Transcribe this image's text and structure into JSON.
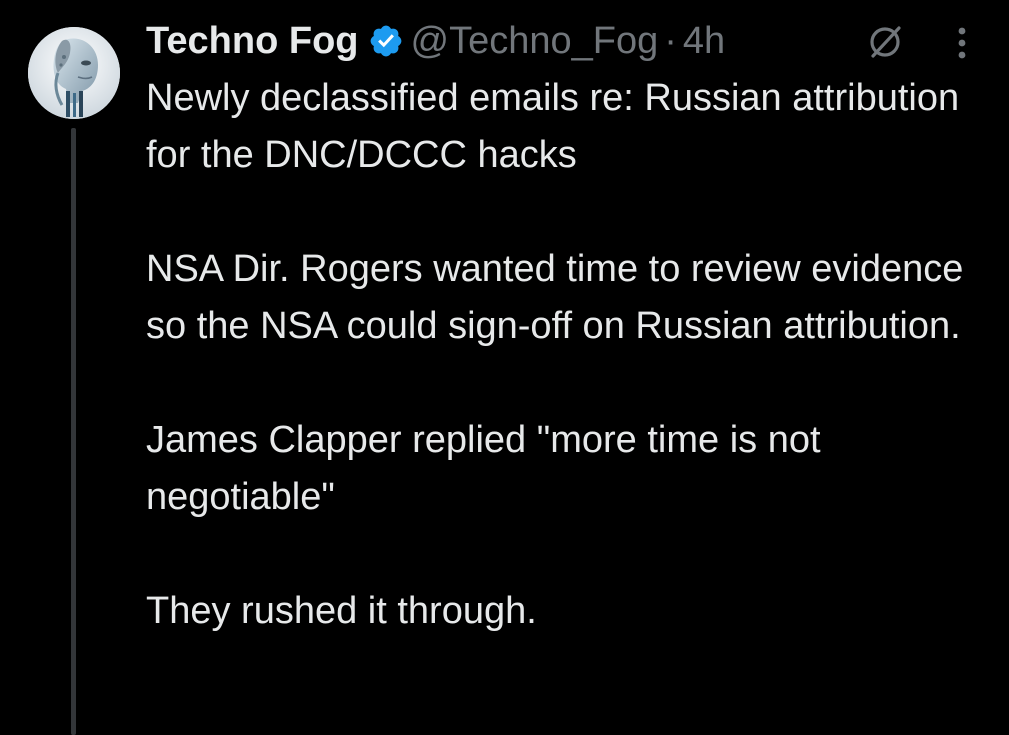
{
  "tweet": {
    "display_name": "Techno Fog",
    "handle": "@Techno_Fog",
    "separator": "·",
    "time": "4h",
    "verified": true,
    "avatar_icon": "robot-face-avatar",
    "paragraphs": [
      "Newly declassified emails re: Russian attribution for the DNC/DCCC hacks",
      "NSA Dir. Rogers wanted time to review evidence so the NSA could sign-off on Russian attribution.",
      "James Clapper replied \"more time is not negotiable\"",
      "They rushed it through."
    ]
  },
  "icons": {
    "verified": "verified-badge-icon",
    "grok": "grok-icon",
    "more": "more-options-icon"
  },
  "colors": {
    "background": "#000000",
    "primary_text": "#e7e9ea",
    "secondary_text": "#71767b",
    "verified_blue": "#1d9bf0",
    "thread_line": "#333639"
  }
}
